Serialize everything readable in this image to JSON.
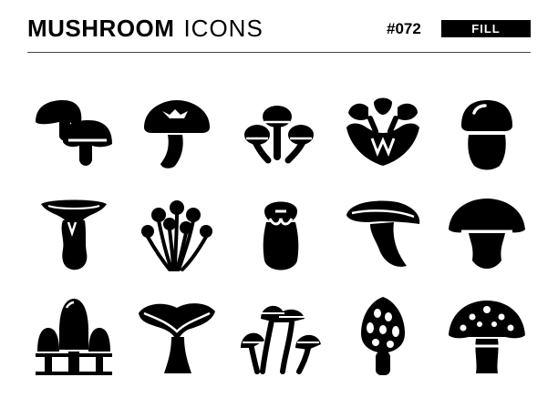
{
  "header": {
    "title_bold": "MUSHROOM",
    "title_light": "ICONS",
    "code": "#072",
    "badge": "FILL"
  },
  "colors": {
    "ink": "#000000",
    "background": "#ffffff",
    "badge_text": "#ffffff"
  },
  "icons": [
    {
      "name": "button-mushrooms-icon"
    },
    {
      "name": "shiitake-icon"
    },
    {
      "name": "nameko-cluster-icon"
    },
    {
      "name": "maitake-icon"
    },
    {
      "name": "porcini-bun-icon"
    },
    {
      "name": "king-oyster-icon"
    },
    {
      "name": "enoki-bunch-icon"
    },
    {
      "name": "matsutake-icon"
    },
    {
      "name": "oyster-mushroom-icon"
    },
    {
      "name": "cep-icon"
    },
    {
      "name": "ink-cap-icon"
    },
    {
      "name": "chanterelle-icon"
    },
    {
      "name": "honey-fungus-cluster-icon"
    },
    {
      "name": "morel-icon"
    },
    {
      "name": "fly-agaric-icon"
    }
  ]
}
